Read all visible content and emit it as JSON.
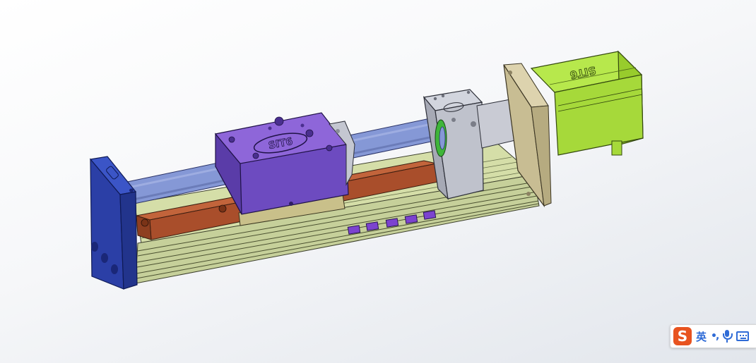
{
  "app": {
    "background_top": "#ffffff",
    "background_bottom": "#e2e6ec"
  },
  "model": {
    "motor_label": "SIT6",
    "block_label": "SIT6",
    "colors": {
      "end_plate": "#2b3fa6",
      "carriage": "#7f55c9",
      "screw": "#7b90d4",
      "rail": "#b2522e",
      "base": "#c9d49a",
      "bearing_block": "#b9bcc8",
      "motor_flange": "#d2c79f",
      "motor": "#a9de3a",
      "slot_nut": "#7c43cf"
    }
  },
  "ime": {
    "logo_icon": "sogou-s-icon",
    "logo_text": "S",
    "lang_label": "英",
    "punct_label": "•,",
    "mic_icon": "microphone-icon",
    "keyboard_icon": "keyboard-icon",
    "accent": "#2f6bd6",
    "logo_color": "#e8531f"
  }
}
